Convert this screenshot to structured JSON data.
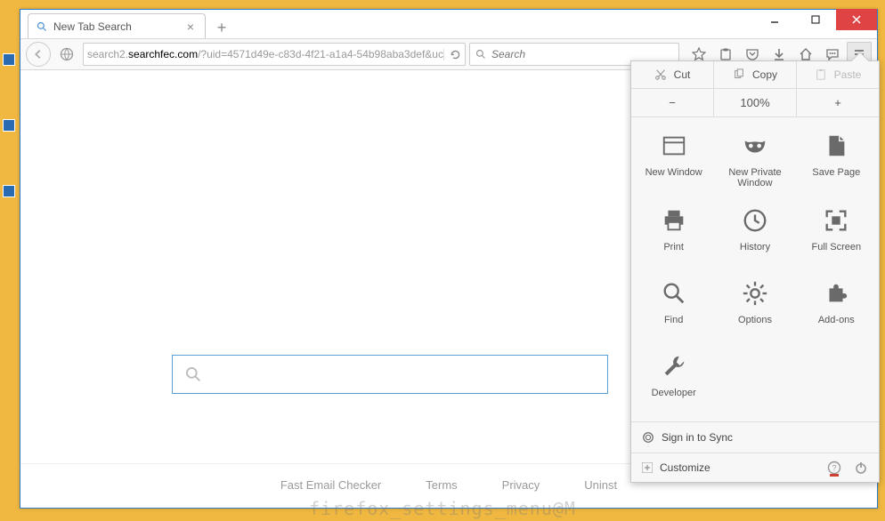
{
  "window": {
    "tab_title": "New Tab Search",
    "url_display_pre": "search2.",
    "url_display_host": "searchfec.com",
    "url_display_path": "/?uid=4571d49e-c83d-4f21-a1a4-54b98aba3def&uc",
    "search_placeholder": "Search"
  },
  "footer": {
    "links": [
      "Fast Email Checker",
      "Terms",
      "Privacy",
      "Uninst"
    ]
  },
  "menu": {
    "clipboard": {
      "cut": "Cut",
      "copy": "Copy",
      "paste": "Paste"
    },
    "zoom": {
      "level": "100%"
    },
    "items": [
      {
        "key": "new_window",
        "label": "New Window"
      },
      {
        "key": "new_private",
        "label": "New Private Window"
      },
      {
        "key": "save_page",
        "label": "Save Page"
      },
      {
        "key": "print",
        "label": "Print"
      },
      {
        "key": "history",
        "label": "History"
      },
      {
        "key": "full_screen",
        "label": "Full Screen"
      },
      {
        "key": "find",
        "label": "Find"
      },
      {
        "key": "options",
        "label": "Options"
      },
      {
        "key": "addons",
        "label": "Add-ons"
      },
      {
        "key": "developer",
        "label": "Developer"
      }
    ],
    "sign_in": "Sign in to Sync",
    "customize": "Customize"
  },
  "watermark": "firefox_settings_menu@M"
}
